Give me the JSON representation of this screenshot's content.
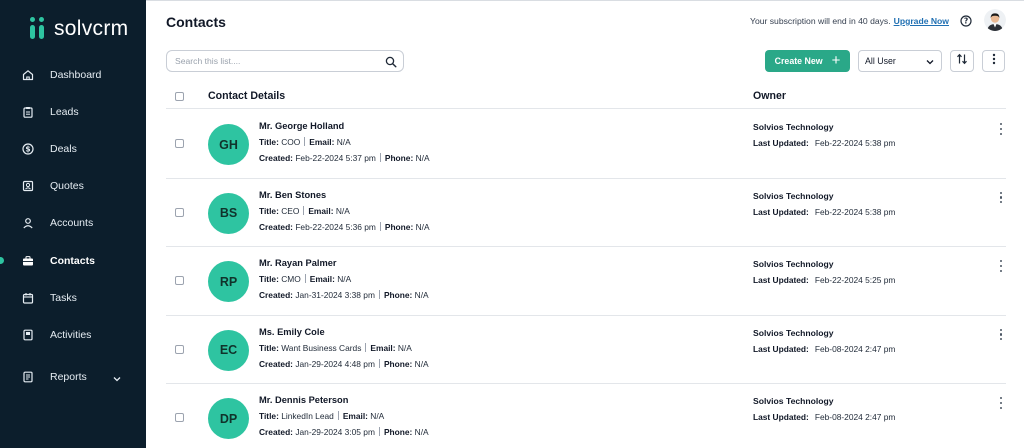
{
  "app": {
    "name": "solvcrm"
  },
  "sidebar": {
    "items": [
      {
        "label": "Dashboard",
        "icon": "home-icon"
      },
      {
        "label": "Leads",
        "icon": "clipboard-icon"
      },
      {
        "label": "Deals",
        "icon": "dollar-icon"
      },
      {
        "label": "Quotes",
        "icon": "quote-card-icon"
      },
      {
        "label": "Accounts",
        "icon": "user-icon"
      },
      {
        "label": "Contacts",
        "icon": "briefcase-icon",
        "active": true
      },
      {
        "label": "Tasks",
        "icon": "calendar-icon"
      },
      {
        "label": "Activities",
        "icon": "book-icon"
      },
      {
        "label": "Reports",
        "icon": "report-icon",
        "has_submenu": true
      }
    ]
  },
  "header": {
    "title": "Contacts",
    "subscription_text": "Your subscription will end in 40 days.",
    "upgrade_label": "Upgrade Now"
  },
  "toolbar": {
    "search_placeholder": "Search this list....",
    "create_label": "Create New",
    "create_plus": "+",
    "user_filter": "All User"
  },
  "table": {
    "columns": {
      "details": "Contact Details",
      "owner": "Owner"
    },
    "labels": {
      "title": "Title:",
      "email": "Email:",
      "created": "Created:",
      "phone": "Phone:",
      "last_updated": "Last Updated:"
    },
    "rows": [
      {
        "initials": "GH",
        "name": "Mr. George Holland",
        "title": "COO",
        "email": "N/A",
        "created": "Feb-22-2024 5:37 pm",
        "phone": "N/A",
        "owner": "Solvios Technology",
        "last_updated": "Feb-22-2024 5:38 pm"
      },
      {
        "initials": "BS",
        "name": "Mr. Ben Stones",
        "title": "CEO",
        "email": "N/A",
        "created": "Feb-22-2024 5:36 pm",
        "phone": "N/A",
        "owner": "Solvios Technology",
        "last_updated": "Feb-22-2024 5:38 pm"
      },
      {
        "initials": "RP",
        "name": "Mr. Rayan Palmer",
        "title": "CMO",
        "email": "N/A",
        "created": "Jan-31-2024 3:38 pm",
        "phone": "N/A",
        "owner": "Solvios Technology",
        "last_updated": "Feb-22-2024 5:25 pm"
      },
      {
        "initials": "EC",
        "name": "Ms. Emily Cole",
        "title": "Want Business Cards",
        "email": "N/A",
        "created": "Jan-29-2024 4:48 pm",
        "phone": "N/A",
        "owner": "Solvios Technology",
        "last_updated": "Feb-08-2024 2:47 pm"
      },
      {
        "initials": "DP",
        "name": "Mr. Dennis Peterson",
        "title": "LinkedIn Lead",
        "email": "N/A",
        "created": "Jan-29-2024 3:05 pm",
        "phone": "N/A",
        "owner": "Solvios Technology",
        "last_updated": "Feb-08-2024 2:47 pm"
      }
    ]
  },
  "colors": {
    "sidebar_bg": "#0c1e2c",
    "accent": "#2ec4a1",
    "create_button": "#2aa888",
    "link": "#1f6fb2"
  }
}
